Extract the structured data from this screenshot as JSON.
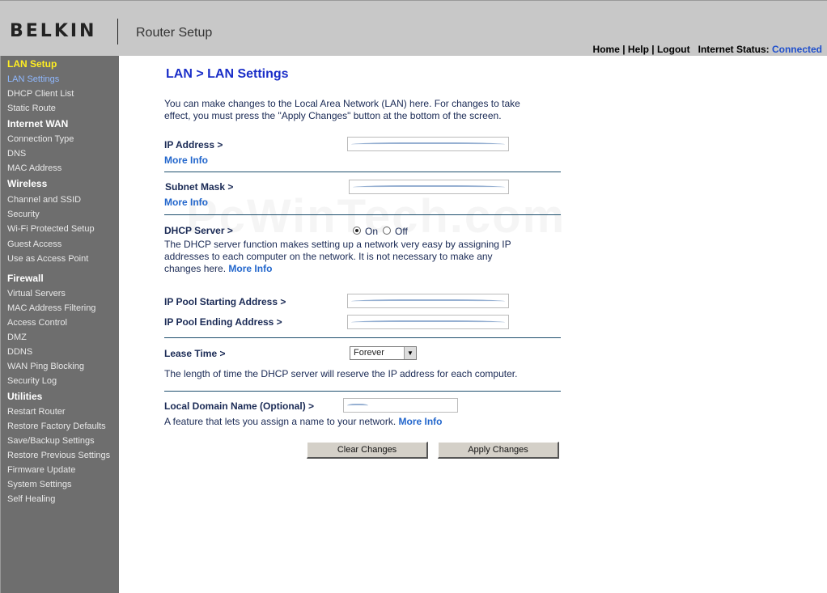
{
  "header": {
    "logo": "BELKIN",
    "app_title": "Router Setup",
    "nav": {
      "home": "Home",
      "sep": " | ",
      "help": "Help",
      "logout": "Logout"
    },
    "status_label": "Internet Status:",
    "status_value": "Connected"
  },
  "sidebar": {
    "lan_setup": "LAN Setup",
    "lan_settings": "LAN Settings",
    "dhcp_client_list": "DHCP Client List",
    "static_route": "Static Route",
    "internet_wan": "Internet WAN",
    "connection_type": "Connection Type",
    "dns": "DNS",
    "mac_address": "MAC Address",
    "wireless": "Wireless",
    "channel_ssid": "Channel and SSID",
    "security": "Security",
    "wps": "Wi-Fi Protected Setup",
    "guest_access": "Guest Access",
    "access_point": "Use as Access Point",
    "firewall": "Firewall",
    "virtual_servers": "Virtual Servers",
    "mac_filtering": "MAC Address Filtering",
    "access_control": "Access Control",
    "dmz": "DMZ",
    "ddns": "DDNS",
    "wan_ping": "WAN Ping Blocking",
    "security_log": "Security Log",
    "utilities": "Utilities",
    "restart_router": "Restart Router",
    "restore_factory": "Restore Factory Defaults",
    "save_backup": "Save/Backup Settings",
    "restore_previous": "Restore Previous Settings",
    "firmware_update": "Firmware Update",
    "system_settings": "System Settings",
    "self_healing": "Self Healing"
  },
  "main": {
    "title": "LAN > LAN Settings",
    "intro": "You can make changes to the Local Area Network (LAN) here. For changes to take effect, you must press the \"Apply Changes\" button at the bottom of the screen.",
    "ip_address_label": "IP Address >",
    "more_info": "More Info",
    "subnet_mask_label": "Subnet Mask >",
    "dhcp_label": "DHCP Server >",
    "dhcp_on": "On",
    "dhcp_off": "Off",
    "dhcp_desc": "The DHCP server function makes setting up a network very easy by assigning IP addresses to each computer on the network. It is not necessary to make any changes here.",
    "pool_start_label": "IP Pool Starting Address >",
    "pool_end_label": "IP Pool Ending Address >",
    "lease_label": "Lease Time >",
    "lease_value": "Forever",
    "lease_desc": "The length of time the DHCP server will reserve the IP address for each computer.",
    "domain_label": "Local Domain Name  (Optional) >",
    "domain_desc": "A feature that lets you assign a name to your network.",
    "clear_button": "Clear Changes",
    "apply_button": "Apply Changes",
    "watermark": "PcWinTech.com"
  },
  "colors": {
    "sidebar_bg": "#6e6e6e",
    "header_bg": "#c8c8c8",
    "title": "#1a2ec8",
    "link": "#2266cc",
    "active_section": "#ffee22"
  }
}
